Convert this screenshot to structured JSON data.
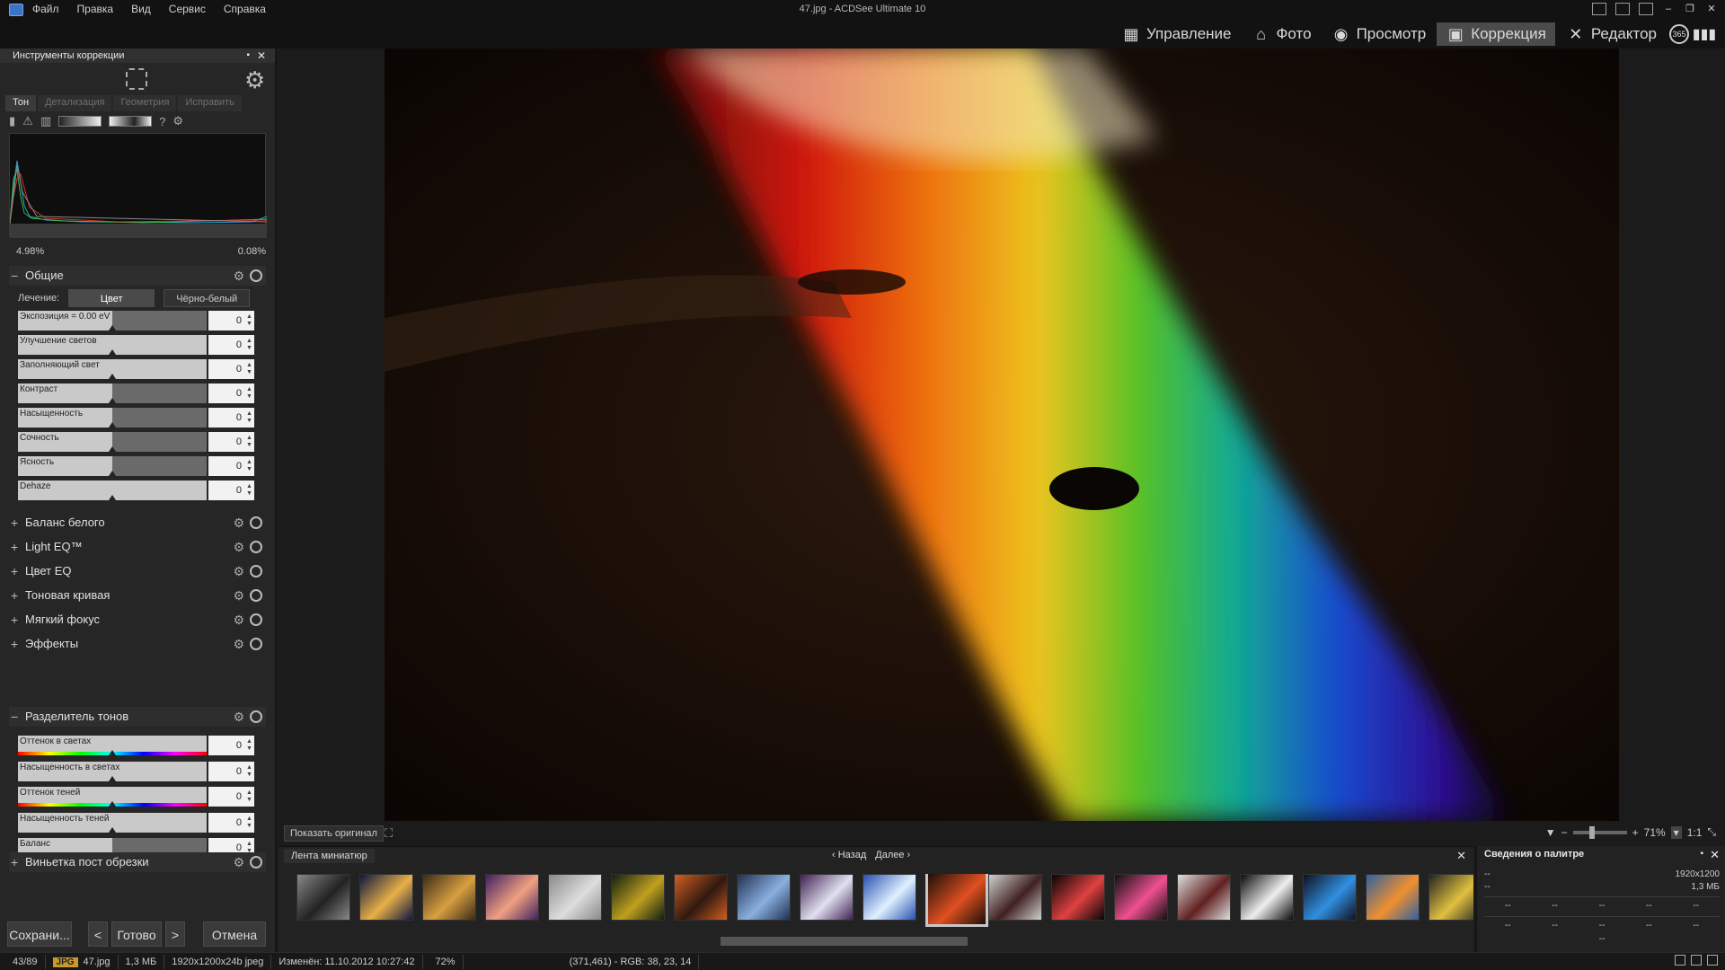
{
  "window": {
    "title": "47.jpg - ACDSee Ultimate 10",
    "menu": [
      "Файл",
      "Правка",
      "Вид",
      "Сервис",
      "Справка"
    ],
    "controls": {
      "minimize": "–",
      "restore": "❐",
      "close": "✕"
    }
  },
  "modes": [
    {
      "label": "Управление",
      "icon": "grid-icon",
      "glyph": "▦"
    },
    {
      "label": "Фото",
      "icon": "photo-tag-icon",
      "glyph": "⌂"
    },
    {
      "label": "Просмотр",
      "icon": "eye-icon",
      "glyph": "◉"
    },
    {
      "label": "Коррекция",
      "icon": "develop-icon",
      "glyph": "▣"
    },
    {
      "label": "Редактор",
      "icon": "tools-icon",
      "glyph": "✕"
    }
  ],
  "extra_icons": {
    "d365": "365",
    "dashboard": "▮▮▮"
  },
  "left_panel": {
    "title": "Инструменты коррекции",
    "tabs": [
      "Тон",
      "Детализация",
      "Геометрия",
      "Исправить"
    ],
    "active_tab": "Тон",
    "histogram": {
      "left_value": "4.98%",
      "right_value": "0.08%"
    },
    "general": {
      "title": "Общие",
      "treatment_label": "Лечение:",
      "treatment_options": [
        "Цвет",
        "Чёрно-белый"
      ],
      "treatment_selected": "Цвет",
      "sliders": [
        {
          "label": "Экспозиция = 0.00 eV",
          "value": "0",
          "level": 0.5
        },
        {
          "label": "Улучшение светов",
          "value": "0",
          "level": 1.0
        },
        {
          "label": "Заполняющий свет",
          "value": "0",
          "level": 1.0
        },
        {
          "label": "Контраст",
          "value": "0",
          "level": 0.5
        },
        {
          "label": "Насыщенность",
          "value": "0",
          "level": 0.5
        },
        {
          "label": "Сочность",
          "value": "0",
          "level": 0.5
        },
        {
          "label": "Ясность",
          "value": "0",
          "level": 0.5
        },
        {
          "label": "Dehaze",
          "value": "0",
          "level": 1.0
        }
      ]
    },
    "collapsed_sections": [
      "Баланс белого",
      "Light EQ™",
      "Цвет EQ",
      "Тоновая кривая",
      "Мягкий фокус",
      "Эффекты"
    ],
    "split_tone": {
      "title": "Разделитель тонов",
      "sliders": [
        {
          "label": "Оттенок в светах",
          "value": "0",
          "hue": true,
          "level": 1.0
        },
        {
          "label": "Насыщенность в светах",
          "value": "0",
          "hue": false,
          "level": 1.0
        },
        {
          "label": "Оттенок теней",
          "value": "0",
          "hue": true,
          "level": 1.0
        },
        {
          "label": "Насыщенность теней",
          "value": "0",
          "hue": false,
          "level": 1.0
        },
        {
          "label": "Баланс",
          "value": "0",
          "hue": false,
          "level": 0.5
        }
      ]
    },
    "vignette": "Виньетка пост обрезки",
    "buttons": {
      "save": "Сохрани...",
      "done": "Готово",
      "cancel": "Отмена",
      "prev": "<",
      "next": ">"
    }
  },
  "viewbar": {
    "show_original": "Показать оригинал",
    "zoom": "71%",
    "ratio": "1:1"
  },
  "filmstrip": {
    "title": "Лента миниатюр",
    "back": "Назад",
    "forward": "Далее",
    "thumb_colors": [
      [
        "#888",
        "#222"
      ],
      [
        "#0b1640",
        "#e8b048"
      ],
      [
        "#3a2a18",
        "#d8a040"
      ],
      [
        "#402060",
        "#f0a080"
      ],
      [
        "#8a8a8a",
        "#ddd"
      ],
      [
        "#102010",
        "#c0a020"
      ],
      [
        "#d06020",
        "#301810"
      ],
      [
        "#203050",
        "#8ab0e0"
      ],
      [
        "#402050",
        "#e0e0f0"
      ],
      [
        "#2850b0",
        "#e0f0ff"
      ],
      [
        "#1a0f08",
        "#e05020"
      ],
      [
        "#d0d0d0",
        "#402020"
      ],
      [
        "#050505",
        "#e04040"
      ],
      [
        "#101010",
        "#f05090"
      ],
      [
        "#e0e0e0",
        "#602020"
      ],
      [
        "#0a0a0a",
        "#eeeeee"
      ],
      [
        "#101020",
        "#3090e0"
      ],
      [
        "#3060a0",
        "#f09030"
      ],
      [
        "#222",
        "#e0c040"
      ]
    ],
    "selected_index": 10
  },
  "palette": {
    "title": "Сведения о палитре",
    "rows": [
      [
        "--",
        "1920x1200"
      ],
      [
        "--",
        "1,3 МБ"
      ]
    ],
    "grid1": [
      "--",
      "--",
      "--",
      "--",
      "--"
    ],
    "grid2": [
      "--",
      "--",
      "--",
      "--",
      "--"
    ],
    "footer": "--"
  },
  "status": {
    "counter": "43/89",
    "badge": "JPG",
    "filename": "47.jpg",
    "size": "1,3 МБ",
    "dims": "1920x1200x24b jpeg",
    "modified": "Изменён: 11.10.2012 10:27:42",
    "zoom": "72%",
    "pixel": "(371,461) - RGB: 38, 23, 14"
  }
}
